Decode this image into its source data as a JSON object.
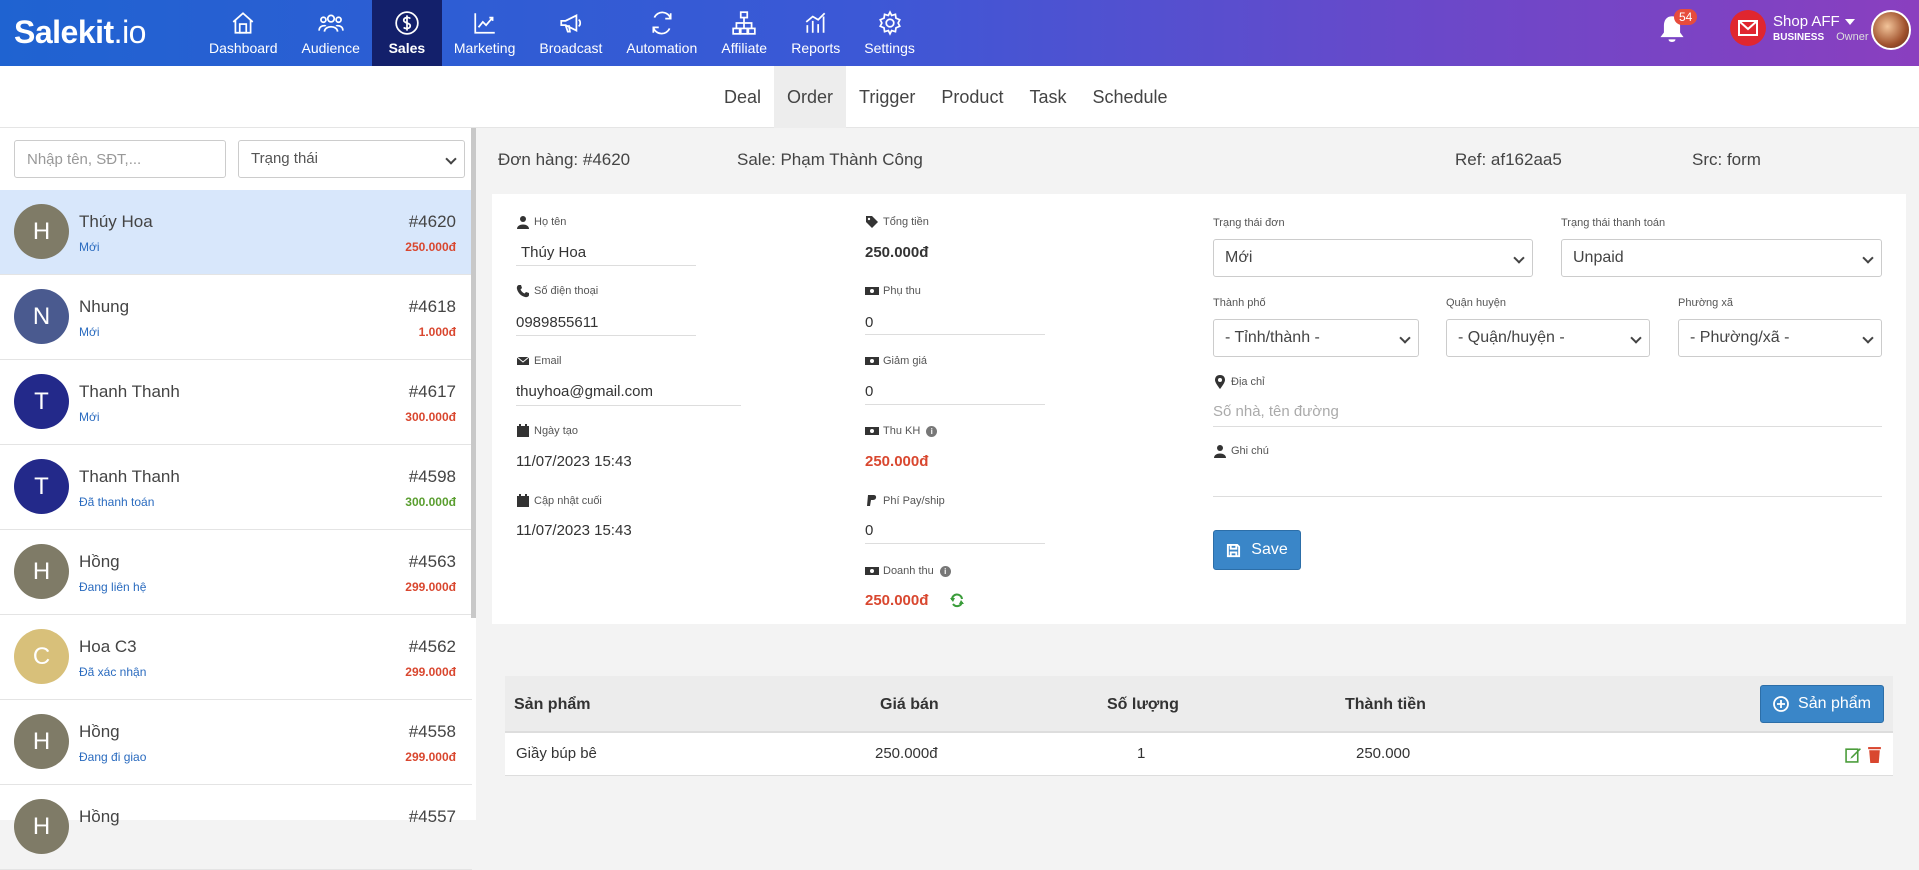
{
  "brand": {
    "logo_main": "Salekit",
    "logo_suffix": ".io"
  },
  "nav": {
    "items": [
      {
        "label": "Dashboard",
        "icon": "home-icon"
      },
      {
        "label": "Audience",
        "icon": "users-icon"
      },
      {
        "label": "Sales",
        "icon": "dollar-icon"
      },
      {
        "label": "Marketing",
        "icon": "chart-line-icon"
      },
      {
        "label": "Broadcast",
        "icon": "megaphone-icon"
      },
      {
        "label": "Automation",
        "icon": "refresh-icon"
      },
      {
        "label": "Affiliate",
        "icon": "sitemap-icon"
      },
      {
        "label": "Reports",
        "icon": "analytics-icon"
      },
      {
        "label": "Settings",
        "icon": "gear-icon"
      }
    ],
    "active": "Sales"
  },
  "notifications": {
    "count": "54"
  },
  "account": {
    "name": "Shop AFF",
    "plan": "BUSINESS",
    "role": "Owner"
  },
  "subnav": {
    "items": [
      "Deal",
      "Order",
      "Trigger",
      "Product",
      "Task",
      "Schedule"
    ],
    "active": "Order"
  },
  "filters": {
    "search_placeholder": "Nhập tên, SĐT,...",
    "status_label": "Trạng thái"
  },
  "orders": [
    {
      "initial": "H",
      "name": "Thúy Hoa",
      "status": "Mới",
      "id": "#4620",
      "amount": "250.000đ",
      "avatar_color": "#7f7b67",
      "amount_color": "#d9472f"
    },
    {
      "initial": "N",
      "name": "Nhung",
      "status": "Mới",
      "id": "#4618",
      "amount": "1.000đ",
      "avatar_color": "#4a5a8f",
      "amount_color": "#d9472f"
    },
    {
      "initial": "T",
      "name": "Thanh Thanh",
      "status": "Mới",
      "id": "#4617",
      "amount": "300.000đ",
      "avatar_color": "#23298a",
      "amount_color": "#d9472f"
    },
    {
      "initial": "T",
      "name": "Thanh Thanh",
      "status": "Đã thanh toán",
      "id": "#4598",
      "amount": "300.000đ",
      "avatar_color": "#23298a",
      "amount_color": "#5a9e2f"
    },
    {
      "initial": "H",
      "name": "Hồng",
      "status": "Đang liên hệ",
      "id": "#4563",
      "amount": "299.000đ",
      "avatar_color": "#7f7b67",
      "amount_color": "#d9472f"
    },
    {
      "initial": "C",
      "name": "Hoa C3",
      "status": "Đã xác nhận",
      "id": "#4562",
      "amount": "299.000đ",
      "avatar_color": "#d8c07a",
      "amount_color": "#d9472f"
    },
    {
      "initial": "H",
      "name": "Hồng",
      "status": "Đang đi giao",
      "id": "#4558",
      "amount": "299.000đ",
      "avatar_color": "#7f7b67",
      "amount_color": "#d9472f"
    },
    {
      "initial": "H",
      "name": "Hồng",
      "status": "",
      "id": "#4557",
      "amount": "",
      "avatar_color": "#7f7b67",
      "amount_color": "#d9472f"
    }
  ],
  "order_header": {
    "order": "Đơn hàng: #4620",
    "sale": "Sale: Phạm Thành Công",
    "ref": "Ref: af162aa5",
    "src": "Src: form"
  },
  "customer": {
    "name_label": "Họ tên",
    "name": "Thúy Hoa",
    "phone_label": "Số điện thoại",
    "phone": "0989855611",
    "email_label": "Email",
    "email": "thuyhoa@gmail.com",
    "created_label": "Ngày tạo",
    "created": "11/07/2023 15:43",
    "updated_label": "Cập nhật cuối",
    "updated": "11/07/2023 15:43"
  },
  "money": {
    "total_label": "Tổng tiền",
    "total": "250.000đ",
    "surcharge_label": "Phụ thu",
    "surcharge": "0",
    "discount_label": "Giảm giá",
    "discount": "0",
    "collect_label": "Thu KH",
    "collect": "250.000đ",
    "fee_label": "Phí Pay/ship",
    "fee": "0",
    "revenue_label": "Doanh thu",
    "revenue": "250.000đ"
  },
  "order_form": {
    "status_label": "Trạng thái đơn",
    "status": "Mới",
    "payment_label": "Trạng thái thanh toán",
    "payment": "Unpaid",
    "city_label": "Thành phố",
    "city": "- Tỉnh/thành -",
    "district_label": "Quận huyện",
    "district": "- Quận/huyện -",
    "ward_label": "Phường xã",
    "ward": "- Phường/xã -",
    "address_label": "Địa chỉ",
    "address_placeholder": "Số nhà, tên đường",
    "note_label": "Ghi chú",
    "save_label": "Save"
  },
  "products": {
    "headers": [
      "Sản phẩm",
      "Giá bán",
      "Số lượng",
      "Thành tiền"
    ],
    "add_label": "Sản phẩm",
    "rows": [
      {
        "name": "Giầy búp bê",
        "price": "250.000đ",
        "qty": "1",
        "total": "250.000"
      }
    ]
  }
}
